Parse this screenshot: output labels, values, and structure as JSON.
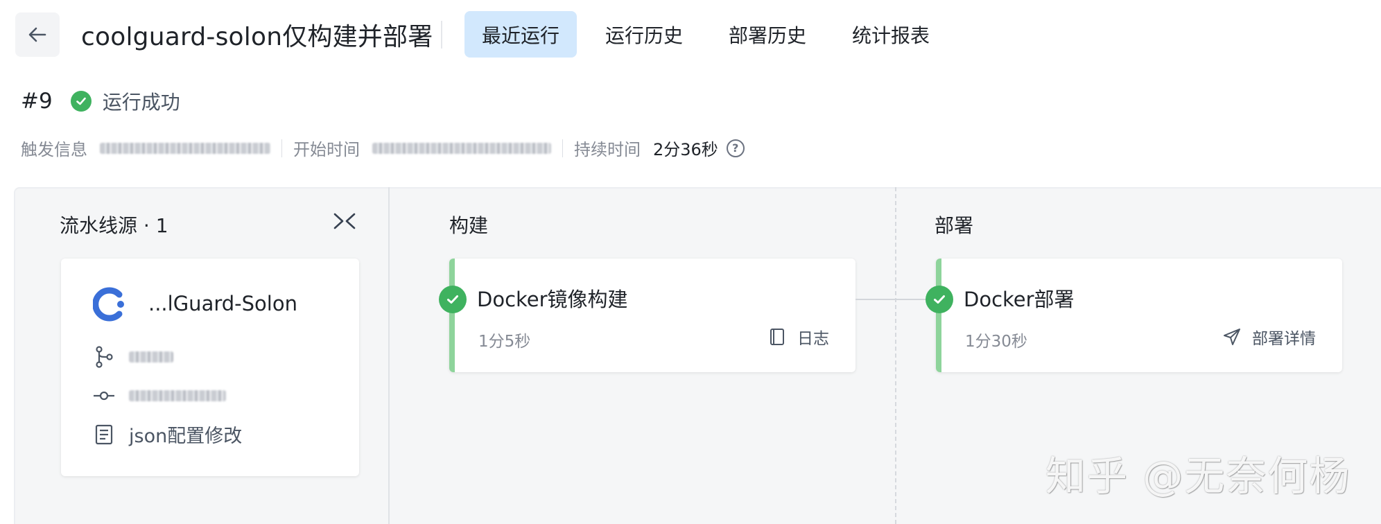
{
  "header": {
    "title": "coolguard-solon仅构建并部署",
    "tabs": [
      {
        "label": "最近运行",
        "active": true
      },
      {
        "label": "运行历史",
        "active": false
      },
      {
        "label": "部署历史",
        "active": false
      },
      {
        "label": "统计报表",
        "active": false
      }
    ]
  },
  "run": {
    "number": "#9",
    "status": "运行成功",
    "status_color": "#3fb25f"
  },
  "meta": {
    "trigger_label": "触发信息",
    "start_label": "开始时间",
    "duration_label": "持续时间",
    "duration_value": "2分36秒"
  },
  "pipeline": {
    "source_column": {
      "title": "流水线源 · 1",
      "card": {
        "name": "...lGuard-Solon",
        "commit_message": "json配置修改"
      }
    },
    "build_column": {
      "title": "构建",
      "job": {
        "name": "Docker镜像构建",
        "duration": "1分5秒",
        "action": "日志"
      }
    },
    "deploy_column": {
      "title": "部署",
      "job": {
        "name": "Docker部署",
        "duration": "1分30秒",
        "action": "部署详情"
      }
    }
  },
  "watermark": "知乎 @无奈何杨",
  "colors": {
    "active_tab_bg": "#d2e8fd",
    "success": "#3fb25f",
    "job_accent": "#8ed49b"
  }
}
